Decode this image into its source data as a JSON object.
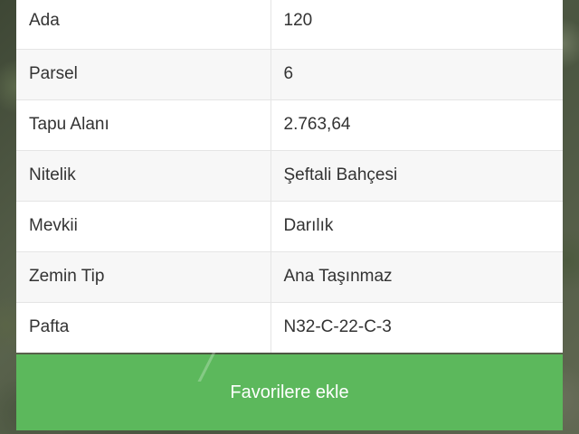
{
  "parcel_info": {
    "rows": [
      {
        "label": "Ada",
        "value": "120"
      },
      {
        "label": "Parsel",
        "value": "6"
      },
      {
        "label": "Tapu Alanı",
        "value": "2.763,64"
      },
      {
        "label": "Nitelik",
        "value": "Şeftali Bahçesi"
      },
      {
        "label": "Mevkii",
        "value": "Darılık"
      },
      {
        "label": "Zemin Tip",
        "value": "Ana Taşınmaz"
      },
      {
        "label": "Pafta",
        "value": "N32-C-22-C-3"
      }
    ]
  },
  "actions": {
    "favorite_label": "Favorilere ekle",
    "favorite_color": "#5cb85c"
  }
}
